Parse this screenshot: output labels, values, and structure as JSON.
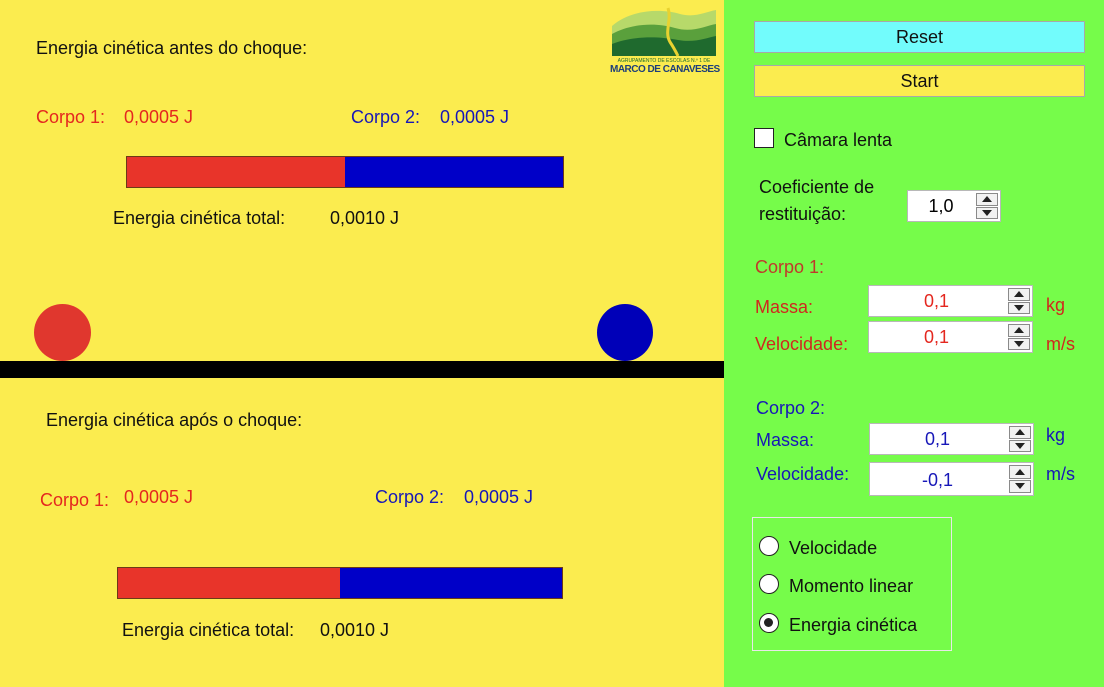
{
  "before": {
    "heading": "Energia cinética antes do choque:",
    "body1_label": "Corpo 1:",
    "body1_value": "0,0005 J",
    "body2_label": "Corpo 2:",
    "body2_value": "0,0005 J",
    "body1_fraction": 0.5,
    "total_label": "Energia cinética total:",
    "total_value": "0,0010 J"
  },
  "after": {
    "heading": "Energia cinética após o choque:",
    "body1_label": "Corpo 1:",
    "body1_value": "0,0005 J",
    "body2_label": "Corpo 2:",
    "body2_value": "0,0005 J",
    "body1_fraction": 0.5,
    "total_label": "Energia cinética total:",
    "total_value": "0,0010 J"
  },
  "logo": {
    "line1": "AGRUPAMENTO DE ESCOLAS N.º 1 DE",
    "line2": "MARCO DE CANAVESES"
  },
  "controls": {
    "reset_label": "Reset",
    "start_label": "Start",
    "slow_motion_label": "Câmara lenta",
    "slow_motion_checked": false,
    "restitution_label_line1": "Coeficiente de",
    "restitution_label_line2": "restituição:",
    "restitution_value": "1,0",
    "body1": {
      "title": "Corpo 1:",
      "mass_label": "Massa:",
      "mass_value": "0,1",
      "mass_unit": "kg",
      "velocity_label": "Velocidade:",
      "velocity_value": "0,1",
      "velocity_unit": "m/s"
    },
    "body2": {
      "title": "Corpo 2:",
      "mass_label": "Massa:",
      "mass_value": "0,1",
      "mass_unit": "kg",
      "velocity_label": "Velocidade:",
      "velocity_value": "-0,1",
      "velocity_unit": "m/s"
    },
    "display_options": [
      {
        "label": "Velocidade",
        "selected": false
      },
      {
        "label": "Momento linear",
        "selected": false
      },
      {
        "label": "Energia cinética",
        "selected": true
      }
    ]
  },
  "colors": {
    "sim_background": "#fbec4f",
    "controls_background": "#76fc4a",
    "body1": "#e4271f",
    "body2": "#1717b8",
    "reset_button": "#72fcfc",
    "start_button": "#fbec4f"
  }
}
